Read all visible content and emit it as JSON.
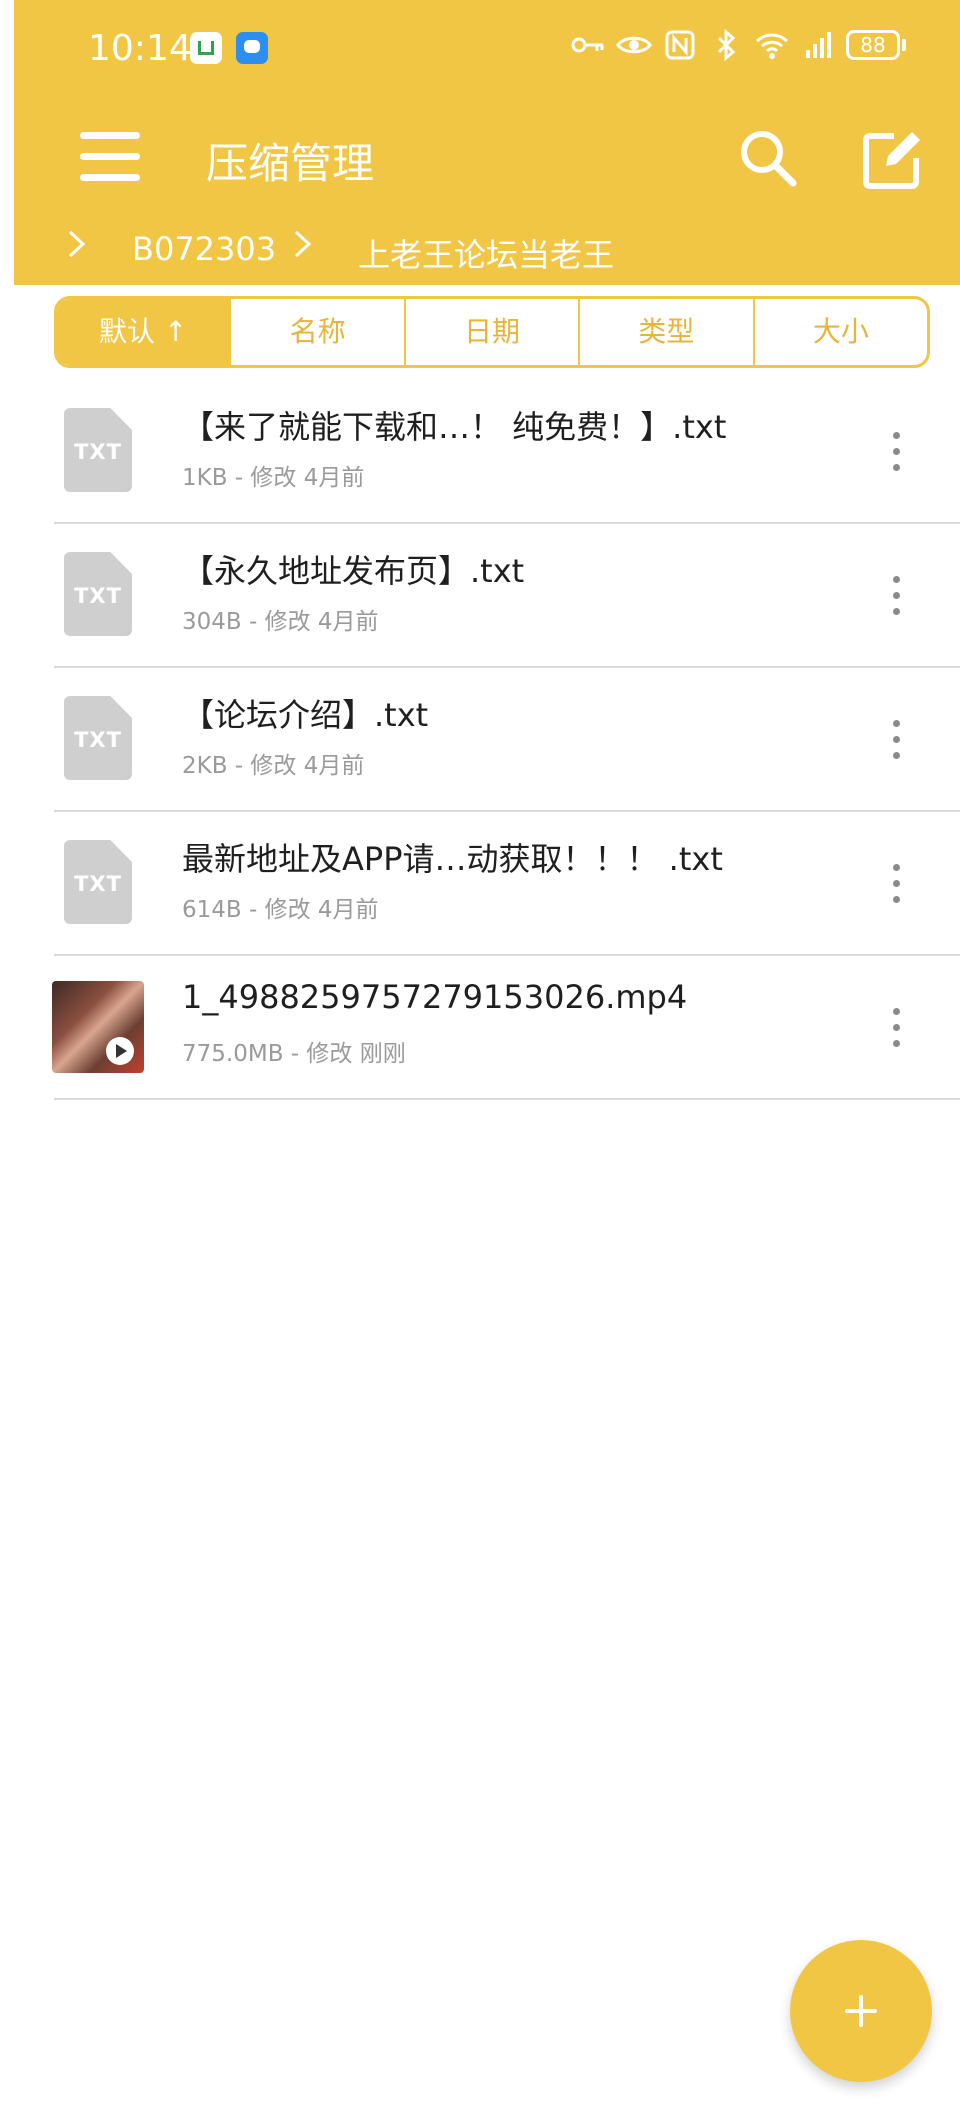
{
  "status_bar": {
    "time": "10:14",
    "battery": "88",
    "icons": [
      "home-app-icon",
      "message-app-icon",
      "key-icon",
      "eye-icon",
      "nfc-icon",
      "bluetooth-icon",
      "wifi-icon",
      "signal-4g-icon"
    ]
  },
  "colors": {
    "accent": "#f1c644",
    "divider": "#d9d9d9",
    "meta_text": "#9a9a9a"
  },
  "toolbar": {
    "title": "压缩管理",
    "icons": [
      "menu-icon",
      "search-icon",
      "edit-icon"
    ]
  },
  "breadcrumb": [
    "B072303",
    "上老王论坛当老王"
  ],
  "sort_tabs": [
    "默认 ↑",
    "名称",
    "日期",
    "类型",
    "大小"
  ],
  "files": [
    {
      "name": "【来了就能下载和…！ 纯免费！】.txt",
      "meta": "1KB - 修改 4月前",
      "icon": "txt-file-icon",
      "ext": "TXT"
    },
    {
      "name": "【永久地址发布页】.txt",
      "meta": "304B - 修改 4月前",
      "icon": "txt-file-icon",
      "ext": "TXT"
    },
    {
      "name": "【论坛介绍】.txt",
      "meta": "2KB - 修改 4月前",
      "icon": "txt-file-icon",
      "ext": "TXT"
    },
    {
      "name": "最新地址及APP请…动获取！！！ .txt",
      "meta": "614B - 修改 4月前",
      "icon": "txt-file-icon",
      "ext": "TXT"
    },
    {
      "name": "1_4988259757279153026.mp4",
      "meta": "775.0MB - 修改 刚刚",
      "icon": "video-thumbnail"
    }
  ],
  "fab": {
    "icon": "plus-icon"
  }
}
